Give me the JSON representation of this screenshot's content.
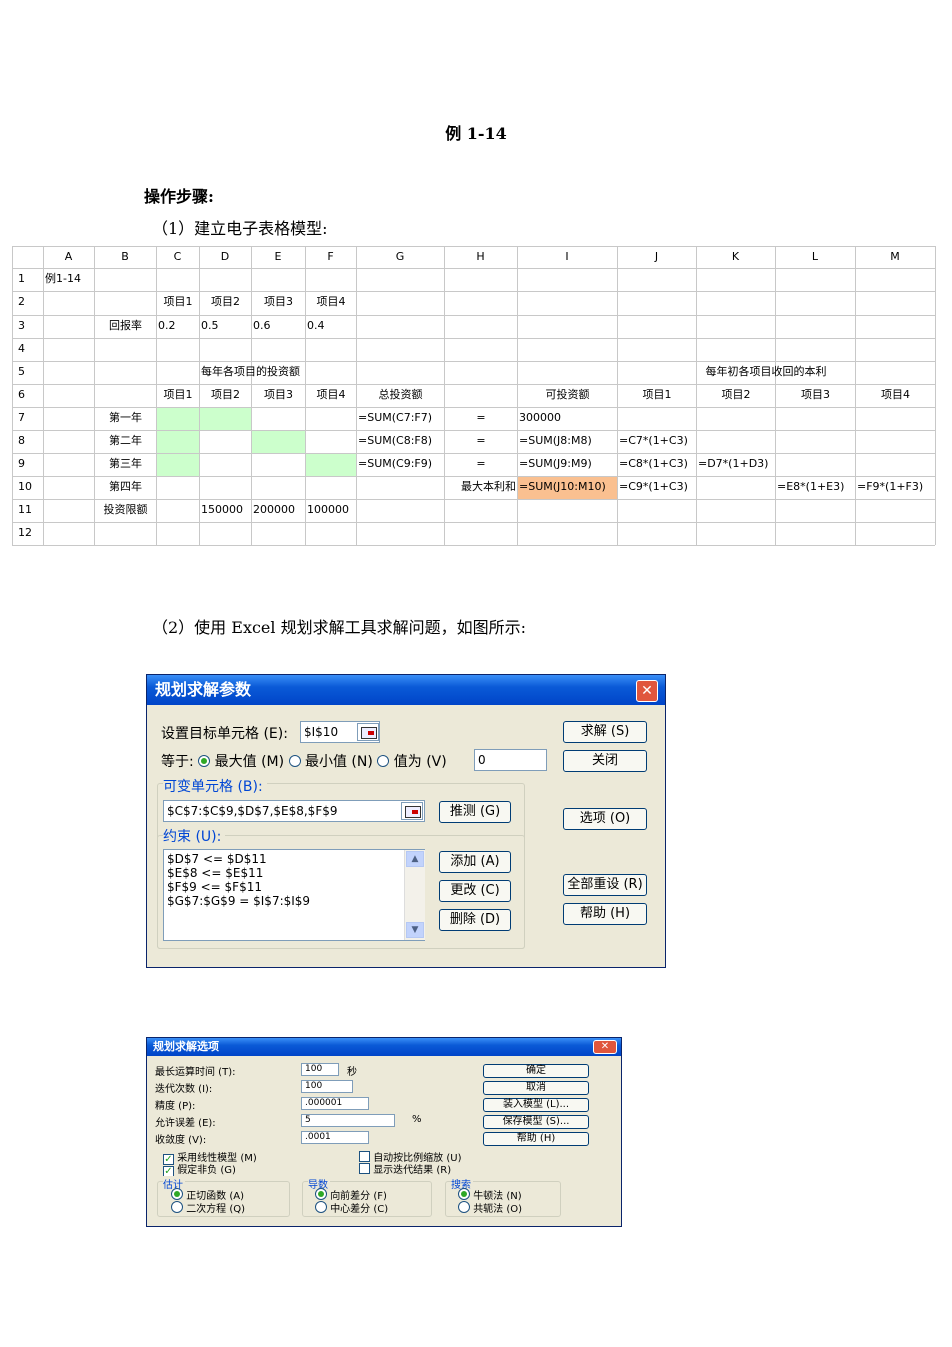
{
  "doc": {
    "title": "例 1-14",
    "steps_heading": "操作步骤:",
    "step1": "（1）建立电子表格模型:",
    "step2": "（2）使用 Excel 规划求解工具求解问题，如图所示:"
  },
  "sheet": {
    "columns": [
      "A",
      "B",
      "C",
      "D",
      "E",
      "F",
      "G",
      "H",
      "I",
      "J",
      "K",
      "L",
      "M"
    ],
    "rows": [
      "1",
      "2",
      "3",
      "4",
      "5",
      "6",
      "7",
      "8",
      "9",
      "10",
      "11",
      "12"
    ],
    "cells": {
      "A1": "例1-14",
      "C2": "项目1",
      "D2": "项目2",
      "E2": "项目3",
      "F2": "项目4",
      "B3": "回报率",
      "C3": "0.2",
      "D3": "0.5",
      "E3": "0.6",
      "F3": "0.4",
      "D5": "每年各项目的投资额",
      "K5": "每年初各项目收回的本利",
      "C6": "项目1",
      "D6": "项目2",
      "E6": "项目3",
      "F6": "项目4",
      "G6": "总投资额",
      "I6": "可投资额",
      "J6": "项目1",
      "K6": "项目2",
      "L6": "项目3",
      "M6": "项目4",
      "B7": "第一年",
      "G7": "=SUM(C7:F7)",
      "H7": "=",
      "I7": "300000",
      "B8": "第二年",
      "G8": "=SUM(C8:F8)",
      "H8": "=",
      "I8": "=SUM(J8:M8)",
      "J8": "=C7*(1+C3)",
      "B9": "第三年",
      "G9": "=SUM(C9:F9)",
      "H9": "=",
      "I9": "=SUM(J9:M9)",
      "J9": "=C8*(1+C3)",
      "K9": "=D7*(1+D3)",
      "B10": "第四年",
      "H10": "最大本利和",
      "I10": "=SUM(J10:M10)",
      "J10": "=C9*(1+C3)",
      "L10": "=E8*(1+E3)",
      "M10": "=F9*(1+F3)",
      "B11": "投资限额",
      "D11": "150000",
      "E11": "200000",
      "F11": "100000"
    },
    "highlight_colors": {
      "changing_cells": "#ccffcc",
      "target_cell": "#fac090"
    }
  },
  "solver": {
    "title": "规划求解参数",
    "set_target_label": "设置目标单元格 (E):",
    "target": "$I$10",
    "equal_to_label": "等于:",
    "opt_max": "最大值 (M)",
    "opt_min": "最小值 (N)",
    "opt_value": "值为 (V)",
    "value": "0",
    "by_changing_label": "可变单元格 (B):",
    "changing": "$C$7:$C$9,$D$7,$E$8,$F$9",
    "guess": "推测 (G)",
    "constraints_label": "约束 (U):",
    "constraints": [
      "$D$7 <= $D$11",
      "$E$8 <= $E$11",
      "$F$9 <= $F$11",
      "$G$7:$G$9 = $I$7:$I$9"
    ],
    "add": "添加 (A)",
    "change": "更改 (C)",
    "delete": "删除 (D)",
    "solve": "求解 (S)",
    "close": "关闭",
    "options": "选项 (O)",
    "reset_all": "全部重设 (R)",
    "help": "帮助 (H)"
  },
  "options": {
    "title": "规划求解选项",
    "max_time_label": "最长运算时间 (T):",
    "max_time": "100",
    "seconds": "秒",
    "iterations_label": "迭代次数 (I):",
    "iterations": "100",
    "precision_label": "精度 (P):",
    "precision": ".000001",
    "tolerance_label": "允许误差 (E):",
    "tolerance": "5",
    "percent": "%",
    "convergence_label": "收敛度 (V):",
    "convergence": ".0001",
    "ok": "确定",
    "cancel": "取消",
    "load": "装入模型 (L)...",
    "save": "保存模型 (S)...",
    "help": "帮助 (H)",
    "linear": "采用线性模型 (M)",
    "nonneg": "假定非负 (G)",
    "auto_scale": "自动按比例缩放 (U)",
    "show_iter": "显示迭代结果 (R)",
    "estimates": "估计",
    "tangent": "正切函数 (A)",
    "quadratic": "二次方程 (Q)",
    "derivatives": "导数",
    "forward": "向前差分 (F)",
    "central": "中心差分 (C)",
    "search": "搜索",
    "newton": "牛顿法 (N)",
    "conjugate": "共轭法 (O)"
  }
}
